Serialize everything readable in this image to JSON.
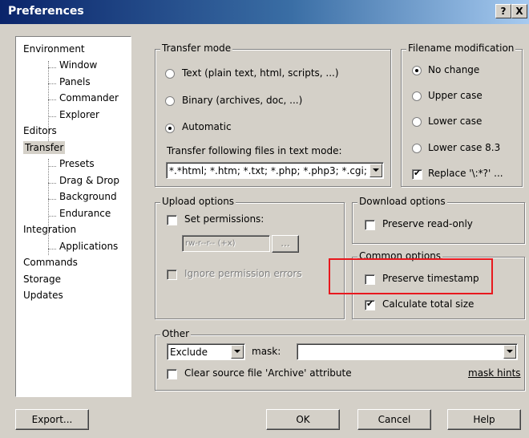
{
  "window": {
    "title": "Preferences",
    "help_btn": "?",
    "close_btn": "X"
  },
  "tree": {
    "items": [
      {
        "label": "Environment"
      },
      {
        "label": "Window"
      },
      {
        "label": "Panels"
      },
      {
        "label": "Commander"
      },
      {
        "label": "Explorer"
      },
      {
        "label": "Editors"
      },
      {
        "label": "Transfer"
      },
      {
        "label": "Presets"
      },
      {
        "label": "Drag & Drop"
      },
      {
        "label": "Background"
      },
      {
        "label": "Endurance"
      },
      {
        "label": "Integration"
      },
      {
        "label": "Applications"
      },
      {
        "label": "Commands"
      },
      {
        "label": "Storage"
      },
      {
        "label": "Updates"
      }
    ],
    "selected": "Transfer"
  },
  "transfer_mode": {
    "title": "Transfer mode",
    "options": [
      "Text (plain text, html, scripts, ...)",
      "Binary (archives, doc, ...)",
      "Automatic"
    ],
    "selected": "Automatic",
    "files_label": "Transfer following files in text mode:",
    "files_value": "*.*html; *.htm; *.txt; *.php; *.php3; *.cgi; *"
  },
  "filename_mod": {
    "title": "Filename modification",
    "options": [
      "No change",
      "Upper case",
      "Lower case",
      "Lower case 8.3"
    ],
    "selected": "No change",
    "replace_label": "Replace '\\:*?' ...",
    "replace_checked": true
  },
  "upload": {
    "title": "Upload options",
    "set_permissions": "Set permissions:",
    "permissions_value": "rw-r--r-- (+x)",
    "dots_btn": "...",
    "ignore_errors": "Ignore permission errors"
  },
  "download": {
    "title": "Download options",
    "preserve_readonly": "Preserve read-only"
  },
  "common": {
    "title": "Common options",
    "preserve_timestamp": "Preserve timestamp",
    "preserve_timestamp_checked": false,
    "calc_total": "Calculate total size",
    "calc_total_checked": true
  },
  "other": {
    "title": "Other",
    "mode_value": "Exclude",
    "mask_label": "mask:",
    "mask_value": "",
    "clear_archive": "Clear source file 'Archive' attribute",
    "mask_hints": "mask hints"
  },
  "buttons": {
    "export": "Export...",
    "ok": "OK",
    "cancel": "Cancel",
    "help": "Help"
  },
  "colors": {
    "highlight": "#e8181e",
    "title_start": "#0a246a",
    "title_end": "#a6caf0"
  }
}
